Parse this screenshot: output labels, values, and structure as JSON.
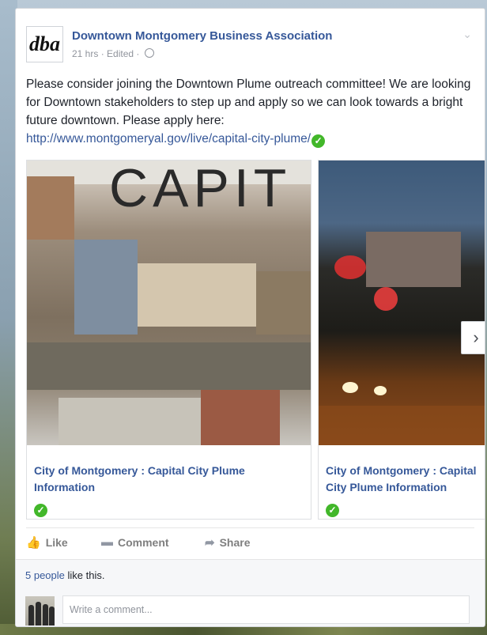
{
  "post": {
    "page_name": "Downtown Montgomery Business Association",
    "logo_text": "dba",
    "time": "21 hrs",
    "edited": "Edited",
    "meta_sep": "·",
    "text": "Please consider joining the Downtown Plume outreach committee! We are looking for Downtown stakeholders to step up and apply so we can look towards a bright future downtown. Please apply here:",
    "link": "http://www.montgomeryal.gov/live/capital-city-plume/",
    "icons": {
      "verified": "check-circle-icon",
      "privacy": "globe-icon",
      "options": "chevron-down-icon"
    }
  },
  "carousel": {
    "slides": [
      {
        "image_text": "CAPIT",
        "caption": "City of Montgomery : Capital City Plume Information"
      },
      {
        "caption": "City of Montgomery : Capital City Plume Information"
      }
    ],
    "next_icon": "chevron-right-icon"
  },
  "actions": {
    "like": "Like",
    "comment": "Comment",
    "share": "Share"
  },
  "footer": {
    "likes_link": "5 people",
    "likes_rest": " like this.",
    "comment_placeholder": "Write a comment..."
  },
  "colors": {
    "link": "#365899",
    "verified": "#42b72a",
    "muted": "#90949c"
  }
}
